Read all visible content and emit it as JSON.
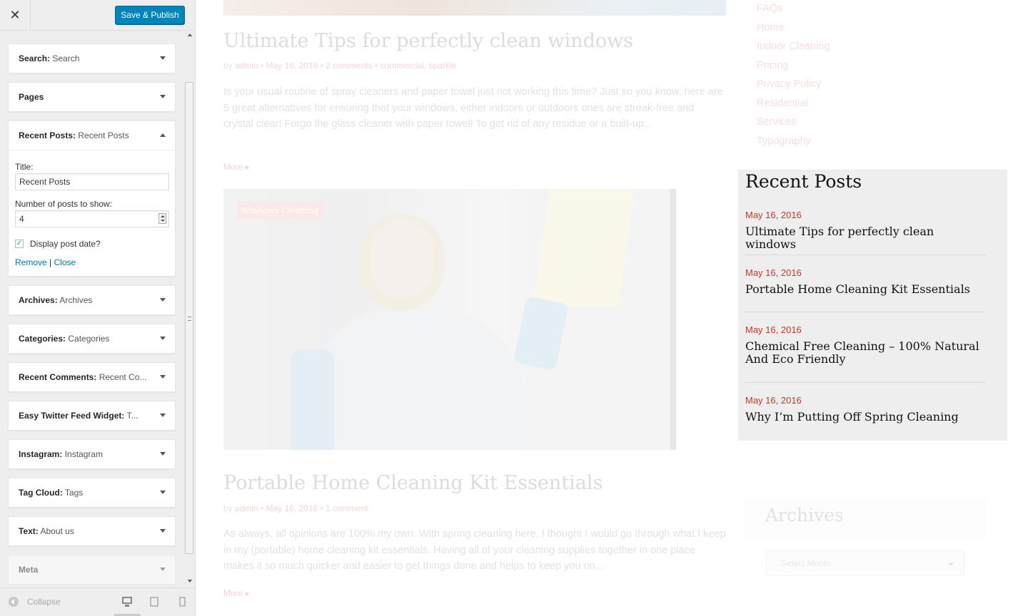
{
  "customizer": {
    "close_label": "✕",
    "publish_label": "Save & Publish",
    "widgets": [
      {
        "title": "Search",
        "instance": "Search"
      },
      {
        "title": "Pages",
        "instance": ""
      },
      {
        "title": "Recent Posts",
        "instance": "Recent Posts",
        "expanded": true
      },
      {
        "title": "Archives",
        "instance": "Archives"
      },
      {
        "title": "Categories",
        "instance": "Categories"
      },
      {
        "title": "Recent Comments",
        "instance": "Recent Co..."
      },
      {
        "title": "Easy Twitter Feed Widget",
        "instance": "T..."
      },
      {
        "title": "Instagram",
        "instance": "Instagram"
      },
      {
        "title": "Tag Cloud",
        "instance": "Tags"
      },
      {
        "title": "Text",
        "instance": "About us"
      },
      {
        "title": "Meta",
        "instance": ""
      }
    ],
    "form": {
      "title_label": "Title:",
      "title_value": "Recent Posts",
      "number_label": "Number of posts to show:",
      "number_value": "4",
      "display_date_label": "Display post date?",
      "display_date_checked": true,
      "remove_label": "Remove",
      "separator": "|",
      "close_label": "Close"
    },
    "footer": {
      "collapse_label": "Collapse"
    }
  },
  "preview": {
    "posts": [
      {
        "title": "Ultimate Tips for perfectly clean windows",
        "meta_prefix": "by",
        "author": "admin",
        "date": "May 16, 2016",
        "comments": "2 comments",
        "categories": "commercial, sparkle",
        "excerpt": "Is your usual routine of spray cleaners and paper towel just not working this time? Just so you know, here are 5 great alternatives for ensuring that your windows, either indoors or outdoors ones are streak-free and crystal clear! Forgo the glass cleaner with paper towel! To get rid of any residue or a built-up...",
        "more": "More ▸"
      },
      {
        "category_badge": "Windows Cleaning",
        "title": "Portable Home Cleaning Kit Essentials",
        "meta_prefix": "by",
        "author": "admin",
        "date": "May 16, 2016",
        "comments": "1 comment",
        "excerpt": "As always, all opinions are 100% my own. With spring cleaning here, I thought I would go through what I keep in my (portable) home cleaning kit essentials. Having all of your cleaning supplies together in one place makes it so much quicker and easier to get things done and helps to keep you on...",
        "more": "More ▸"
      }
    ],
    "page_links": [
      "FAQs",
      "Home",
      "Indoor Cleaning",
      "Pricing",
      "Privacy Policy",
      "Residential",
      "Services",
      "Typography"
    ],
    "recent_posts": {
      "title": "Recent Posts",
      "items": [
        {
          "date": "May 16, 2016",
          "title": "Ultimate Tips for perfectly clean windows"
        },
        {
          "date": "May 16, 2016",
          "title": "Portable Home Cleaning Kit Essentials"
        },
        {
          "date": "May 16, 2016",
          "title": "Chemical Free Cleaning – 100% Natural And Eco Friendly"
        },
        {
          "date": "May 16, 2016",
          "title": "Why I’m Putting Off Spring Cleaning"
        }
      ]
    },
    "archives": {
      "title": "Archives",
      "select_placeholder": "Select Month"
    }
  }
}
